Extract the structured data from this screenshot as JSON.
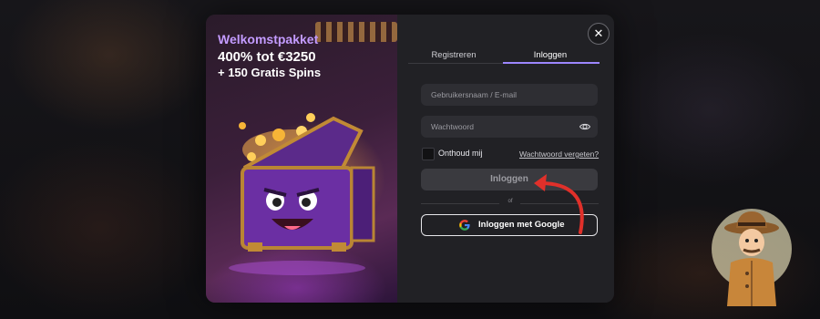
{
  "promo": {
    "title": "Welkomstpakket",
    "offer": "400% tot €3250",
    "spins": "+ 150 Gratis Spins"
  },
  "tabs": [
    {
      "label": "Registreren",
      "active": false
    },
    {
      "label": "Inloggen",
      "active": true
    }
  ],
  "form": {
    "username_placeholder": "Gebruikersnaam / E-mail",
    "password_placeholder": "Wachtwoord",
    "remember_label": "Onthoud mij",
    "forgot_label": "Wachtwoord vergeten?",
    "login_label": "Inloggen",
    "or_label": "of",
    "google_label": "Inloggen met Google"
  },
  "icons": {
    "close": "close-icon",
    "eye": "eye-icon",
    "google": "google-icon"
  },
  "colors": {
    "accent": "#9c86ff",
    "promo_title": "#c39bff",
    "annotation_arrow": "#e0302a"
  }
}
